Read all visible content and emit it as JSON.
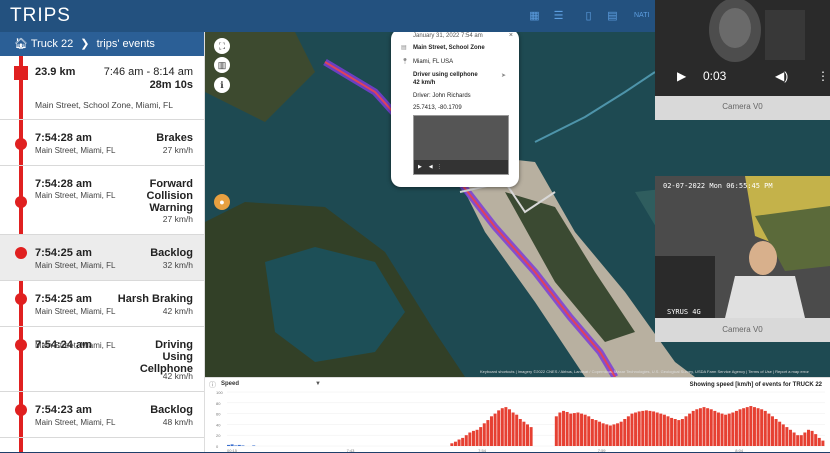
{
  "header": {
    "title": "TRIPS",
    "extra": "NATI"
  },
  "breadcrumb": {
    "vehicle": "Truck 22",
    "section": "trips' events"
  },
  "trip": {
    "distance": "23.9 km",
    "time_range": "7:46 am - 8:14 am",
    "duration": "28m 10s",
    "route": "Main Street, School Zone, Miami, FL"
  },
  "events": [
    {
      "time": "7:54:28 am",
      "type": "Brakes",
      "place": "Main Street, Miami, FL",
      "speed": "27 km/h"
    },
    {
      "time": "7:54:28 am",
      "type": "Forward Collision Warning",
      "place": "Main Street, Miami, FL",
      "speed": "27 km/h"
    },
    {
      "time": "7:54:25 am",
      "type": "Backlog",
      "place": "Main Street, Miami, FL",
      "speed": "32 km/h"
    },
    {
      "time": "7:54:25 am",
      "type": "Harsh Braking",
      "place": "Main Street, Miami, FL",
      "speed": "42 km/h"
    },
    {
      "time": "7:54:24 am",
      "type": "Driving Using Cellphone",
      "place": "Main Street, Miami, FL",
      "speed": "42 km/h"
    },
    {
      "time": "7:54:23 am",
      "type": "Backlog",
      "place": "Main Street, Miami, FL",
      "speed": "48 km/h"
    }
  ],
  "popup": {
    "date": "January 31, 2022 7:54 am",
    "street": "Main Street, School Zone",
    "city": "Miami, FL USA",
    "event": "Driver using cellphone",
    "speed": "42 km/h",
    "driver": "Driver: John Richards",
    "coords": "25.7413, -80.1709"
  },
  "camera1": {
    "time": "0:03",
    "label": "Camera V0"
  },
  "camera2": {
    "timestamp": "02-07-2022 Mon 06:55:45 PM",
    "brand": "SYRUS 4G",
    "label": "Camera V0"
  },
  "map_credits": "Keyboard shortcuts | Imagery ©2022 CNES / Airbus, Landsat / Copernicus, Maxar Technologies, U.S. Geological Survey, USDA Farm Service Agency | Terms of Use | Report a map error",
  "chart": {
    "selector": "Speed",
    "title": "Showing speed [km/h] of events for TRUCK 22",
    "y_ticks": [
      "100",
      "80",
      "60",
      "40",
      "20",
      "0"
    ],
    "x_ticks": [
      "00:15",
      "7:43",
      "7:54",
      "7:59",
      "8:04"
    ]
  },
  "colors": {
    "accent": "#e02020",
    "header": "#23517f",
    "crumb": "#2b5f96"
  },
  "chart_data": {
    "type": "bar",
    "title": "Showing speed [km/h] of events for TRUCK 22",
    "ylim": [
      0,
      100
    ],
    "values": [
      2,
      3,
      1,
      2,
      1,
      0,
      0,
      1,
      0,
      0,
      0,
      0,
      0,
      0,
      0,
      0,
      0,
      0,
      0,
      0,
      0,
      0,
      0,
      0,
      0,
      0,
      0,
      0,
      0,
      0,
      0,
      0,
      0,
      0,
      0,
      0,
      0,
      0,
      0,
      0,
      0,
      0,
      0,
      0,
      0,
      0,
      0,
      0,
      0,
      0,
      0,
      0,
      0,
      0,
      0,
      0,
      0,
      0,
      0,
      0,
      0,
      0,
      5,
      8,
      12,
      15,
      20,
      25,
      28,
      30,
      35,
      42,
      48,
      55,
      60,
      66,
      70,
      72,
      68,
      62,
      58,
      50,
      45,
      40,
      35,
      0,
      0,
      0,
      0,
      0,
      0,
      55,
      62,
      65,
      63,
      60,
      61,
      62,
      60,
      58,
      55,
      50,
      48,
      45,
      42,
      40,
      38,
      40,
      42,
      45,
      50,
      55,
      60,
      62,
      64,
      65,
      66,
      65,
      64,
      62,
      60,
      58,
      55,
      52,
      50,
      48,
      50,
      55,
      60,
      65,
      68,
      70,
      72,
      70,
      68,
      65,
      62,
      60,
      58,
      60,
      62,
      65,
      68,
      70,
      72,
      74,
      72,
      70,
      68,
      65,
      60,
      55,
      50,
      45,
      40,
      35,
      30,
      25,
      20,
      20,
      25,
      30,
      28,
      22,
      15,
      10
    ]
  }
}
